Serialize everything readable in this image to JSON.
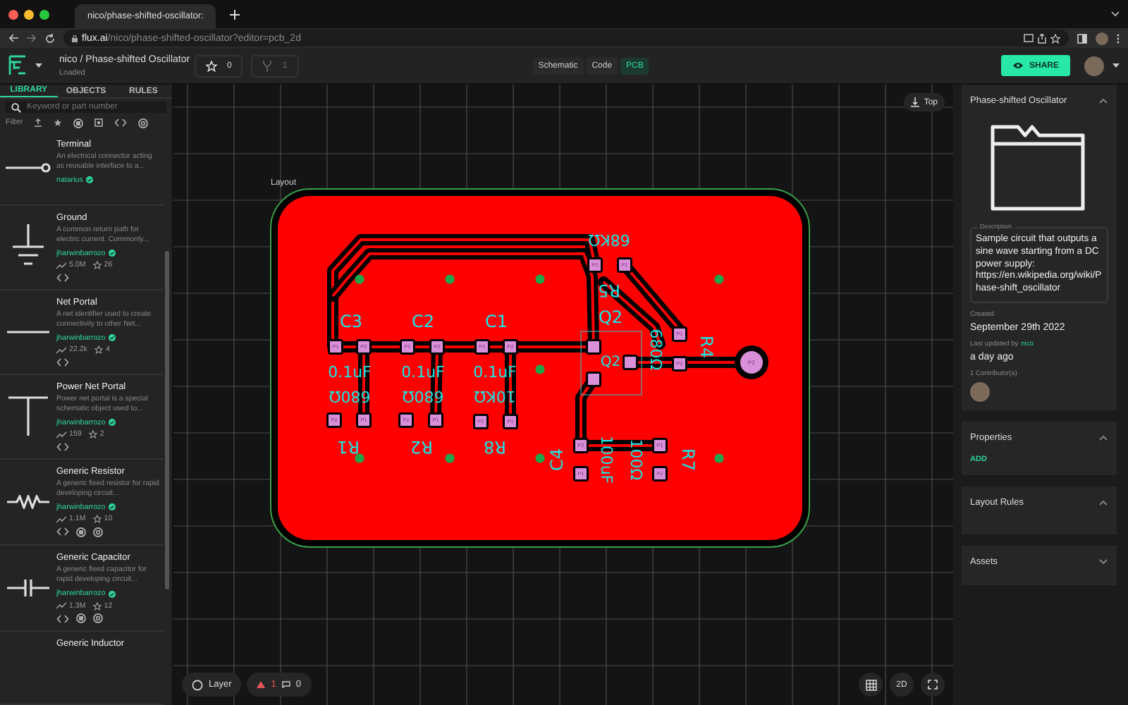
{
  "browser": {
    "tab_title": "nico/phase-shifted-oscillator:",
    "url_host": "flux.ai",
    "url_path": "/nico/phase-shifted-oscillator?editor=pcb_2d"
  },
  "header": {
    "project_path": "nico / Phase-shifted Oscillator",
    "status": "Loaded",
    "star_count": "0",
    "fork_count": "1",
    "editor_tabs": [
      {
        "label": "Schematic",
        "selected": false
      },
      {
        "label": "Code",
        "selected": false
      },
      {
        "label": "PCB",
        "selected": true
      }
    ],
    "share_button": "SHARE"
  },
  "left_panel": {
    "tabs": [
      {
        "label": "LIBRARY",
        "selected": true
      },
      {
        "label": "OBJECTS",
        "selected": false
      },
      {
        "label": "RULES",
        "selected": false
      }
    ],
    "search": {
      "placeholder": "Keyword or part number"
    },
    "filter_label": "Filter",
    "parts": [
      {
        "kind": "terminal",
        "name": "Terminal",
        "description": "An electrical connector acting as reusable interface to a...",
        "author": "natarius"
      },
      {
        "kind": "ground",
        "name": "Ground",
        "description": "A common return path for electric current. Commonly...",
        "author": "jharwinbarrozo",
        "uses": "5.0M",
        "stars": "26",
        "code": true
      },
      {
        "kind": "net",
        "name": "Net Portal",
        "description": "A net identifier used to create connectivity to other Net...",
        "author": "jharwinbarrozo",
        "uses": "22.2k",
        "stars": "4",
        "code": true
      },
      {
        "kind": "power",
        "name": "Power Net Portal",
        "description": "Power net portal is a special schematic object used to...",
        "author": "jharwinbarrozo",
        "uses": "159",
        "stars": "2",
        "code": true
      },
      {
        "kind": "resistor",
        "name": "Generic Resistor",
        "description": "A generic fixed resistor for rapid developing circuit...",
        "author": "jharwinbarrozo",
        "uses": "1.1M",
        "stars": "10",
        "code": true,
        "chip": true,
        "gear": true
      },
      {
        "kind": "capacitor",
        "name": "Generic Capacitor",
        "description": "A generic fixed capacitor for rapid developing circuit...",
        "author": "jharwinbarrozo",
        "uses": "1.3M",
        "stars": "12",
        "code": true,
        "chip": true,
        "gear": true
      },
      {
        "kind": "inductor",
        "name": "Generic Inductor"
      }
    ]
  },
  "canvas": {
    "view_button": "Top",
    "board_label": "Layout",
    "components": [
      {
        "designator": "C3",
        "value": "0.1uF",
        "pads": [
          "P1",
          "P2"
        ]
      },
      {
        "designator": "C2",
        "value": "0.1uF",
        "pads": [
          "P1",
          "P2"
        ]
      },
      {
        "designator": "C1",
        "value": "0.1uF",
        "pads": [
          "P1",
          "P2"
        ]
      },
      {
        "designator": "R1",
        "value": "680Ω",
        "pads": [
          "P2",
          "P1"
        ]
      },
      {
        "designator": "R2",
        "value": "680Ω",
        "pads": [
          "P2",
          "P1"
        ]
      },
      {
        "designator": "R8",
        "value": "10KΩ",
        "pads": [
          "P2",
          "P1"
        ]
      },
      {
        "designator": "R5",
        "value": "68KΩ",
        "pads": [
          "P2",
          "P1"
        ]
      },
      {
        "designator": "Q2",
        "body_label": "Q2"
      },
      {
        "designator": "R4",
        "value": "680Ω",
        "pads": [
          "P1",
          "P2"
        ]
      },
      {
        "designator": "C4",
        "value": "100uF",
        "pads": [
          "P2",
          "P1"
        ]
      },
      {
        "designator": "R7",
        "value": "100Ω",
        "pads": [
          "P1",
          "P2"
        ]
      },
      {
        "pads": [
          "P2"
        ]
      }
    ],
    "layer_button": "Layer",
    "warnings": "1",
    "comments": "0",
    "view_mode": "2D"
  },
  "right_panel": {
    "title": "Phase-shifted Oscillator",
    "description_label": "Description",
    "description": "Sample circuit that outputs a sine wave starting from a DC power supply: https://en.wikipedia.org/wiki/Phase-shift_oscillator",
    "created_label": "Created",
    "created": "September 29th 2022",
    "updated_label": "Last updated by",
    "updated_by": "nico",
    "updated": "a day ago",
    "contributors": "1 Contributor(s)",
    "sections": [
      {
        "title": "Properties",
        "expanded": true,
        "action": "ADD"
      },
      {
        "title": "Layout Rules",
        "expanded": true
      },
      {
        "title": "Assets",
        "expanded": false
      }
    ]
  }
}
